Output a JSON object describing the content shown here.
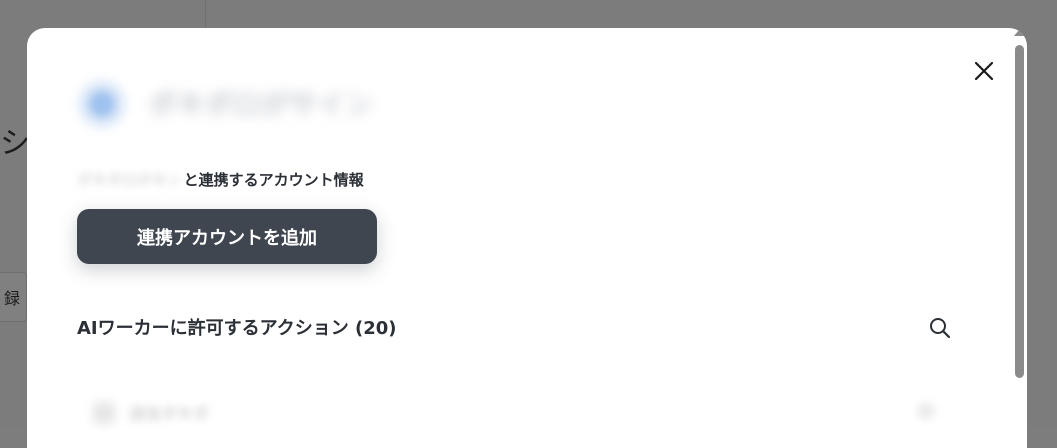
{
  "background": {
    "heading_fragment": "シ",
    "tab_fragment": "録"
  },
  "modal": {
    "app": {
      "name": "ボキボロがサイン"
    },
    "account": {
      "service_name": "ボキボロボキン",
      "label": "と連携するアカウント情報"
    },
    "add_account_button": "連携アカウントを追加",
    "actions_section_title": "AIワーカーに許可するアクション (20)",
    "first_action_label": "送信ボキボ",
    "close_icon": "close-icon",
    "search_icon": "search-icon"
  },
  "colors": {
    "overlay": "#7c7c7c",
    "primary_button": "#3f4650",
    "text_dark": "#2b2f36"
  }
}
